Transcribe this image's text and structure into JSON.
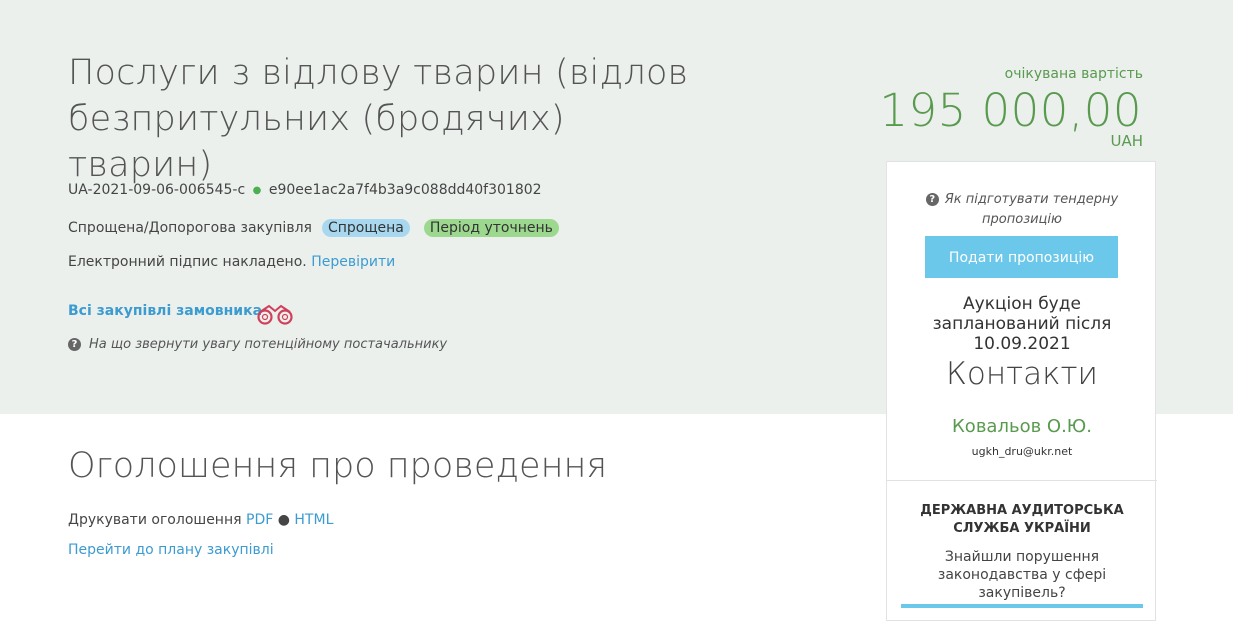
{
  "tender": {
    "title": "Послуги з відлову тварин (відлов безпритульних (бродячих) тварин)",
    "id": "UA-2021-09-06-006545-c",
    "hash": "e90ee1ac2a7f4b3a9c088dd40f301802",
    "procedure_type": "Спрощена/Допорогова закупівля",
    "badge_type": "Спрощена",
    "badge_status": "Період уточнень",
    "signature_text": "Електронний підпис накладено.",
    "signature_link": "Перевірити",
    "buyer_link": "Всі закупівлі замовника",
    "hint": "На що звернути увагу потенційному постачальнику"
  },
  "value": {
    "label": "очікувана вартість",
    "amount": "195 000,00",
    "currency": "UAH"
  },
  "side": {
    "how_to": "Як підготувати тендерну пропозицію",
    "submit_label": "Подати пропозицію",
    "auction_text": "Аукціон буде запланований після 10.09.2021",
    "contacts_title": "Контакти",
    "contact_name": "Ковальов О.Ю.",
    "contact_email": "ugkh_dru@ukr.net",
    "audit_title": "ДЕРЖАВНА АУДИТОРСЬКА СЛУЖБА УКРАЇНИ",
    "audit_text": "Знайшли порушення законодавства у сфері закупівель?"
  },
  "announcement": {
    "title": "Оголошення про проведення",
    "print_label": "Друкувати оголошення",
    "pdf_link": "PDF",
    "html_link": "HTML",
    "plan_link": "Перейти до плану закупівлі"
  },
  "colors": {
    "hero_bg": "#ebf0ed",
    "accent_green": "#5a9a4f",
    "link_blue": "#3c9bd0",
    "button_blue": "#6cc8ea"
  }
}
